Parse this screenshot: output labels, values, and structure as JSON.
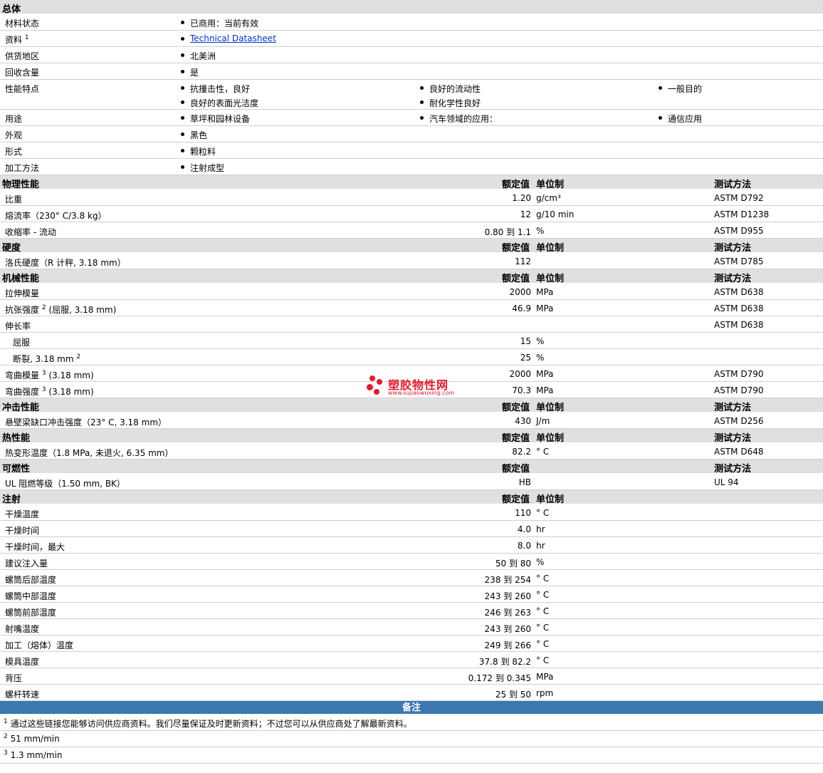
{
  "general": {
    "title": "总体",
    "rows": [
      {
        "label": "材料状态",
        "items": [
          "已商用：当前有效"
        ]
      },
      {
        "label": "资料",
        "sup": "1",
        "items": [
          "Technical Datasheet"
        ],
        "link": true
      },
      {
        "label": "供货地区",
        "items": [
          "北美洲"
        ]
      },
      {
        "label": "回收含量",
        "items": [
          "是"
        ]
      },
      {
        "label": "性能特点",
        "items": [
          "抗撞击性，良好",
          "良好的流动性",
          "一般目的",
          "良好的表面光洁度",
          "耐化学性良好"
        ]
      },
      {
        "label": "用途",
        "items": [
          "草坪和园林设备",
          "汽车领域的应用：",
          "通信应用"
        ]
      },
      {
        "label": "外观",
        "items": [
          "黑色"
        ]
      },
      {
        "label": "形式",
        "items": [
          "颗粒料"
        ]
      },
      {
        "label": "加工方法",
        "items": [
          "注射成型"
        ]
      }
    ]
  },
  "headers": {
    "value": "额定值",
    "unit": "单位制",
    "method": "测试方法"
  },
  "sections": [
    {
      "title": "物理性能",
      "showUnit": true,
      "showMethod": true,
      "rows": [
        {
          "label": "比重",
          "value": "1.20",
          "unit": "g/cm³",
          "method": "ASTM D792"
        },
        {
          "label": "熔流率（230° C/3.8 kg）",
          "value": "12",
          "unit": "g/10 min",
          "method": "ASTM D1238"
        },
        {
          "label": "收缩率 - 流动",
          "value": "0.80 到  1.1",
          "unit": "%",
          "method": "ASTM D955"
        }
      ]
    },
    {
      "title": "硬度",
      "showUnit": true,
      "showMethod": true,
      "rows": [
        {
          "label": "洛氏硬度（R 计秤, 3.18 mm）",
          "value": "112",
          "unit": "",
          "method": "ASTM D785"
        }
      ]
    },
    {
      "title": "机械性能",
      "showUnit": true,
      "showMethod": true,
      "rows": [
        {
          "label": "拉伸模量",
          "value": "2000",
          "unit": "MPa",
          "method": "ASTM D638"
        },
        {
          "label": "抗张强度",
          "sup": "2",
          "suffix": " (屈服, 3.18 mm)",
          "value": "46.9",
          "unit": "MPa",
          "method": "ASTM D638"
        },
        {
          "label": "伸长率",
          "value": "",
          "unit": "",
          "method": "ASTM D638"
        },
        {
          "label": "屈服",
          "indent": true,
          "value": "15",
          "unit": "%",
          "method": ""
        },
        {
          "label": "断裂, 3.18 mm",
          "sup": "2",
          "indent": true,
          "value": "25",
          "unit": "%",
          "method": ""
        },
        {
          "label": "弯曲模量",
          "sup": "3",
          "suffix": " (3.18 mm)",
          "value": "2000",
          "unit": "MPa",
          "method": "ASTM D790"
        },
        {
          "label": "弯曲强度",
          "sup": "3",
          "suffix": " (3.18 mm)",
          "value": "70.3",
          "unit": "MPa",
          "method": "ASTM D790"
        }
      ]
    },
    {
      "title": "冲击性能",
      "showUnit": true,
      "showMethod": true,
      "rows": [
        {
          "label": "悬壁梁缺口冲击强度（23° C, 3.18 mm）",
          "value": "430",
          "unit": "J/m",
          "method": "ASTM D256"
        }
      ]
    },
    {
      "title": "热性能",
      "showUnit": true,
      "showMethod": true,
      "rows": [
        {
          "label": "热变形温度（1.8 MPa, 未退火, 6.35 mm）",
          "value": "82.2",
          "unit": "° C",
          "method": "ASTM D648"
        }
      ]
    },
    {
      "title": "可燃性",
      "showUnit": false,
      "showMethod": true,
      "rows": [
        {
          "label": "UL 阻燃等级（1.50 mm, BK）",
          "value": "HB",
          "unit": "",
          "method": "UL 94"
        }
      ]
    },
    {
      "title": "注射",
      "showUnit": true,
      "showMethod": false,
      "rows": [
        {
          "label": "干燥温度",
          "value": "110",
          "unit": "° C",
          "method": ""
        },
        {
          "label": "干燥时间",
          "value": "4.0",
          "unit": "hr",
          "method": ""
        },
        {
          "label": "干燥时间，最大",
          "value": "8.0",
          "unit": "hr",
          "method": ""
        },
        {
          "label": "建议注入量",
          "value": "50 到  80",
          "unit": "%",
          "method": ""
        },
        {
          "label": "螺筒后部温度",
          "value": "238 到  254",
          "unit": "° C",
          "method": ""
        },
        {
          "label": "螺筒中部温度",
          "value": "243 到  260",
          "unit": "° C",
          "method": ""
        },
        {
          "label": "螺筒前部温度",
          "value": "246 到  263",
          "unit": "° C",
          "method": ""
        },
        {
          "label": "射嘴温度",
          "value": "243 到  260",
          "unit": "° C",
          "method": ""
        },
        {
          "label": "加工（熔体）温度",
          "value": "249 到  266",
          "unit": "° C",
          "method": ""
        },
        {
          "label": "模具温度",
          "value": "37.8 到  82.2",
          "unit": "° C",
          "method": ""
        },
        {
          "label": "背压",
          "value": "0.172 到  0.345",
          "unit": "MPa",
          "method": ""
        },
        {
          "label": "螺杆转速",
          "value": "25 到  50",
          "unit": "rpm",
          "method": ""
        }
      ]
    }
  ],
  "notes": {
    "title": "备注",
    "items": [
      {
        "num": "1",
        "text": "通过这些链接您能够访问供应商资料。我们尽量保证及时更新资料；不过您可以从供应商处了解最新资料。"
      },
      {
        "num": "2",
        "text": "51 mm/min"
      },
      {
        "num": "3",
        "text": "1.3 mm/min"
      }
    ]
  },
  "watermark": {
    "name": "塑胶物性网",
    "url": "www.sujiaowuxing.com",
    "color": "#e8192c"
  }
}
